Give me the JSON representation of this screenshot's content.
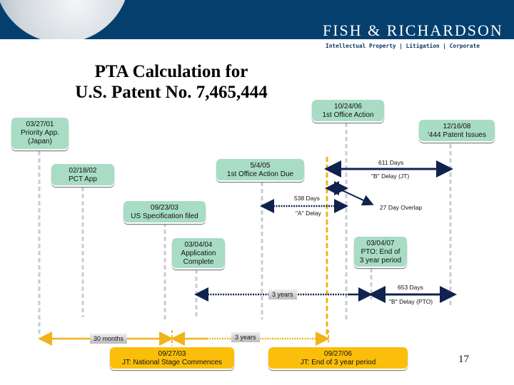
{
  "header": {
    "brand": "FISH & RICHARDSON",
    "tagline": "Intellectual Property  |  Litigation  |  Corporate",
    "colors": {
      "band": "#043f6e",
      "event_box": "#a8dcc4",
      "jt_box": "#fbbf0b",
      "arrow": "#10224e",
      "jt_line": "#f0b418"
    }
  },
  "title": {
    "line1": "PTA Calculation for",
    "line2": "U.S. Patent No. 7,465,444"
  },
  "events": [
    {
      "date": "03/27/01",
      "label": "Priority App.",
      "label2": "(Japan)"
    },
    {
      "date": "02/18/02",
      "label": "PCT App"
    },
    {
      "date": "09/23/03",
      "label": "US Specification filed"
    },
    {
      "date": "03/04/04",
      "label": "Application",
      "label2": "Complete"
    },
    {
      "date": "5/4/05",
      "label": "1st Office  Action Due"
    },
    {
      "date": "10/24/06",
      "label": "1st Office Action"
    },
    {
      "date": "03/04/07",
      "label": "PTO: End of",
      "label2": "3 year period"
    },
    {
      "date": "12/16/08",
      "label": "'444 Patent Issues"
    }
  ],
  "jt_events": [
    {
      "date": "09/27/03",
      "label": "JT: National Stage Commences"
    },
    {
      "date": "09/27/06",
      "label": "JT: End of 3 year period"
    }
  ],
  "intervals": {
    "b_delay_jt": {
      "days": "611 Days",
      "label": "\"B\" Delay (JT)"
    },
    "a_delay": {
      "days": "538 Days",
      "label": "\"A\" Delay"
    },
    "overlap": {
      "label": "27 Day Overlap"
    },
    "pto_three_years": {
      "label": "3 years"
    },
    "b_delay_pto": {
      "days": "653 Days",
      "label": "\"B\" Delay (PTO)"
    },
    "jt_30_months": {
      "label": "30 months"
    },
    "jt_three_years": {
      "label": "3 years"
    }
  },
  "page_number": "17"
}
